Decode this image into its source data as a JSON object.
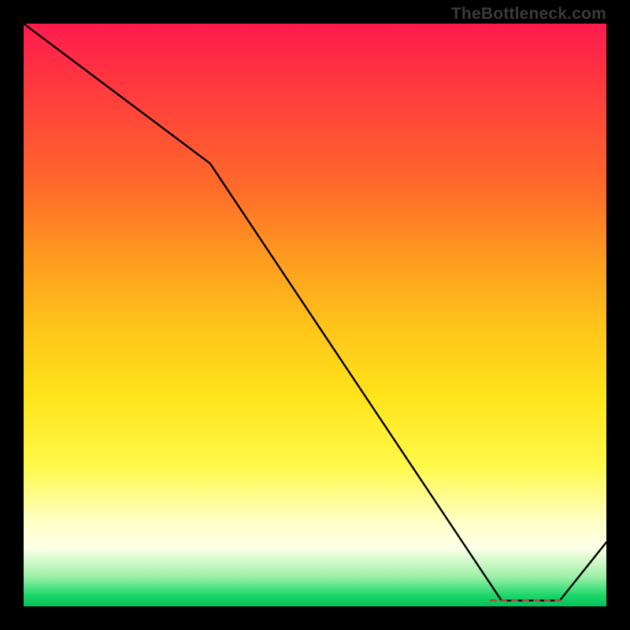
{
  "attribution": "TheBottleneck.com",
  "colors": {
    "curve": "#000000",
    "dash": "#b4493f"
  },
  "chart_data": {
    "type": "line",
    "title": "",
    "xlabel": "",
    "ylabel": "",
    "xlim": [
      0,
      100
    ],
    "ylim": [
      0,
      100
    ],
    "grid": false,
    "legend": false,
    "x": [
      0,
      32,
      82,
      92,
      100
    ],
    "values": [
      100,
      76,
      1,
      1,
      11
    ],
    "note": "Values estimated from pixel positions; the chart has no visible tick labels or axis text.",
    "dash_marker": {
      "x_start": 80,
      "x_end": 93,
      "y": 1,
      "segments": 7
    }
  }
}
